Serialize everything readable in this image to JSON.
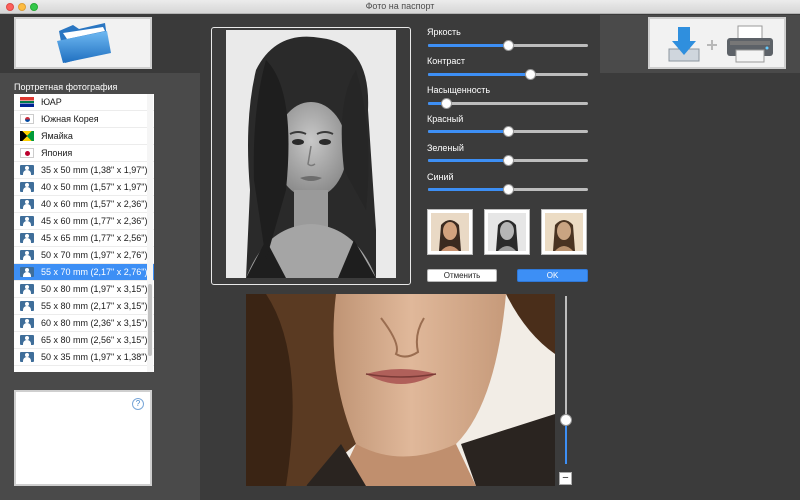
{
  "window": {
    "title": "Фото на паспорт"
  },
  "list": {
    "header": "Портретная фотография",
    "items": [
      {
        "label": "ЮАР",
        "icon": "flag-za"
      },
      {
        "label": "Южная Корея",
        "icon": "flag-kr"
      },
      {
        "label": "Ямайка",
        "icon": "flag-jm"
      },
      {
        "label": "Япония",
        "icon": "flag-jp"
      },
      {
        "label": "35 x 50 mm (1,38\" x 1,97\")",
        "icon": "person"
      },
      {
        "label": "40 x 50 mm (1,57\" x 1,97\")",
        "icon": "person"
      },
      {
        "label": "40 x 60 mm (1,57\" x 2,36\")",
        "icon": "person"
      },
      {
        "label": "45 x 60 mm (1,77\" x 2,36\")",
        "icon": "person"
      },
      {
        "label": "45 x 65 mm (1,77\" x 2,56\")",
        "icon": "person"
      },
      {
        "label": "50 x 70 mm (1,97\" x 2,76\")",
        "icon": "person"
      },
      {
        "label": "55 x 70 mm (2,17\" x 2,76\")",
        "icon": "person",
        "selected": true
      },
      {
        "label": "50 x 80 mm (1,97\" x 3,15\")",
        "icon": "person"
      },
      {
        "label": "55 x 80 mm (2,17\" x 3,15\")",
        "icon": "person"
      },
      {
        "label": "60 x 80 mm (2,36\" x 3,15\")",
        "icon": "person"
      },
      {
        "label": "65 x 80 mm (2,56\" x 3,15\")",
        "icon": "person"
      },
      {
        "label": "50 x 35 mm (1,97\" x 1,38\")",
        "icon": "person"
      }
    ]
  },
  "help": {
    "symbol": "?"
  },
  "adjustments": [
    {
      "label": "Яркость",
      "value": 0.5
    },
    {
      "label": "Контраст",
      "value": 0.64
    },
    {
      "label": "Насыщенность",
      "value": 0.11
    },
    {
      "label": "Красный",
      "value": 0.5
    },
    {
      "label": "Зеленый",
      "value": 0.5
    },
    {
      "label": "Синий",
      "value": 0.5
    }
  ],
  "buttons": {
    "cancel": "Отменить",
    "ok": "OK"
  },
  "zoom": {
    "value": 0.26,
    "minus": "−"
  },
  "colors": {
    "accent": "#3d8ff5",
    "background": "#3b3b3b",
    "panel": "#4a4a4a"
  }
}
